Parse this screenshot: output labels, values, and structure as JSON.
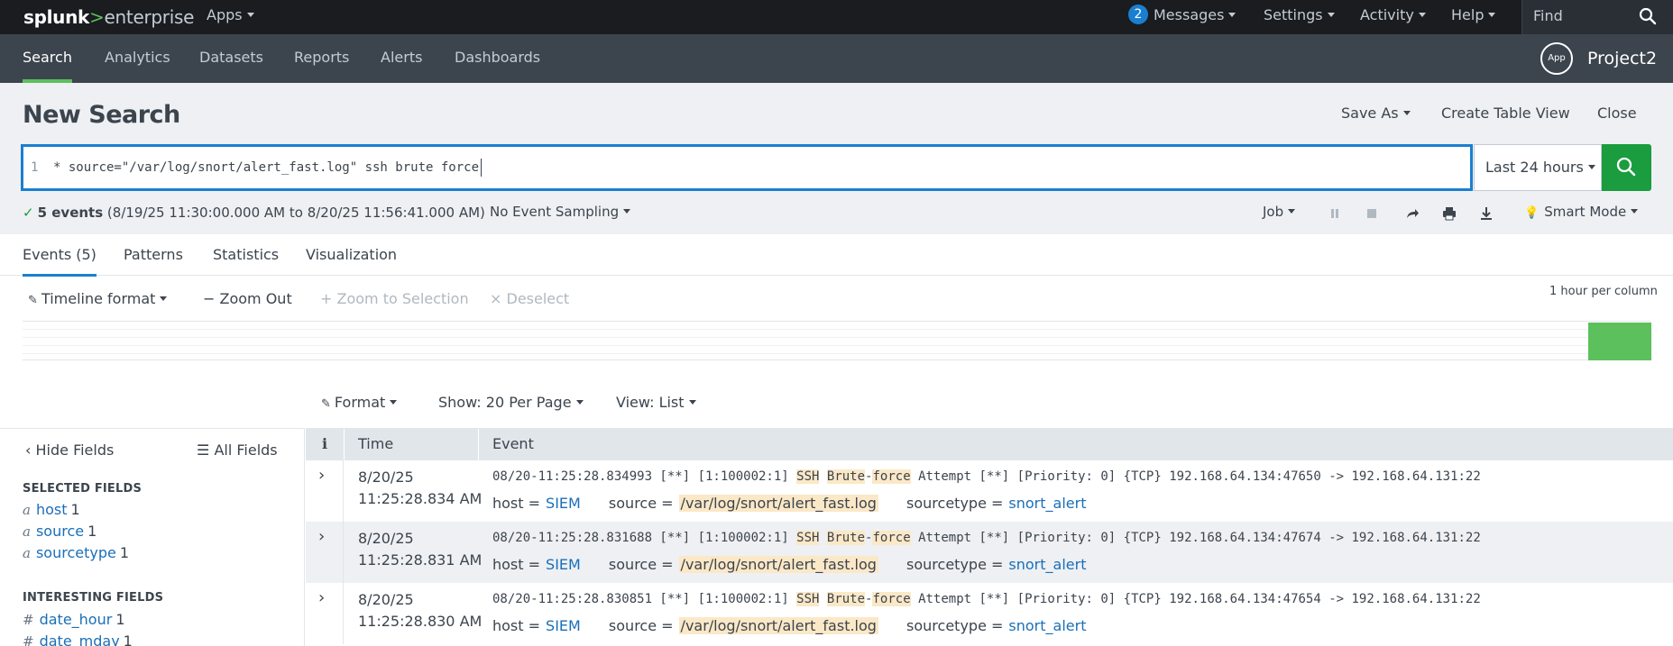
{
  "topbar": {
    "logo_splunk": "splunk",
    "logo_gt": ">",
    "logo_enterprise": "enterprise",
    "apps": "Apps",
    "messages_count": "2",
    "messages": "Messages",
    "settings": "Settings",
    "activity": "Activity",
    "help": "Help",
    "find": "Find"
  },
  "appnav": {
    "tabs": [
      "Search",
      "Analytics",
      "Datasets",
      "Reports",
      "Alerts",
      "Dashboards"
    ],
    "app_icon": "App",
    "app_name": "Project2"
  },
  "header": {
    "title": "New Search",
    "save_as": "Save As",
    "create_table": "Create Table View",
    "close": "Close"
  },
  "search": {
    "line_number": "1",
    "query": "* source=\"/var/log/snort/alert_fast.log\" ssh brute force",
    "time_range": "Last 24 hours"
  },
  "status": {
    "check": "✓",
    "count": "5 events",
    "range": "(8/19/25 11:30:00.000 AM to 8/20/25 11:56:41.000 AM)",
    "sampling": "No Event Sampling",
    "job": "Job",
    "mode": "Smart Mode"
  },
  "result_tabs": [
    "Events (5)",
    "Patterns",
    "Statistics",
    "Visualization"
  ],
  "timeline": {
    "format": "Timeline format",
    "zoom_out": "Zoom Out",
    "zoom_selection": "Zoom to Selection",
    "deselect": "Deselect",
    "scale": "1 hour per column"
  },
  "format_row": {
    "format": "Format",
    "show": "Show: 20 Per Page",
    "view": "View: List"
  },
  "sidebar": {
    "hide_fields": "Hide Fields",
    "all_fields": "All Fields",
    "selected_heading": "SELECTED FIELDS",
    "selected": [
      {
        "type": "a",
        "name": "host",
        "count": "1"
      },
      {
        "type": "a",
        "name": "source",
        "count": "1"
      },
      {
        "type": "a",
        "name": "sourcetype",
        "count": "1"
      }
    ],
    "interesting_heading": "INTERESTING FIELDS",
    "interesting": [
      {
        "type": "#",
        "name": "date_hour",
        "count": "1"
      },
      {
        "type": "#",
        "name": "date_mday",
        "count": "1"
      }
    ]
  },
  "table": {
    "col_info": "i",
    "col_time": "Time",
    "col_event": "Event",
    "rows": [
      {
        "date": "8/20/25",
        "time": "11:25:28.834 AM",
        "raw_pre": "08/20-11:25:28.834993  [**] [1:100002:1] ",
        "raw_w1": "SSH",
        "raw_w2": "Brute",
        "raw_dash": "-",
        "raw_w3": "force",
        "raw_post": " Attempt [**] [Priority: 0] {TCP} 192.168.64.134:47650 -> 192.168.64.131:22",
        "host": "SIEM",
        "source": "/var/log/snort/alert_fast.log",
        "sourcetype": "snort_alert"
      },
      {
        "date": "8/20/25",
        "time": "11:25:28.831 AM",
        "raw_pre": "08/20-11:25:28.831688  [**] [1:100002:1] ",
        "raw_w1": "SSH",
        "raw_w2": "Brute",
        "raw_dash": "-",
        "raw_w3": "force",
        "raw_post": " Attempt [**] [Priority: 0] {TCP} 192.168.64.134:47674 -> 192.168.64.131:22",
        "host": "SIEM",
        "source": "/var/log/snort/alert_fast.log",
        "sourcetype": "snort_alert"
      },
      {
        "date": "8/20/25",
        "time": "11:25:28.830 AM",
        "raw_pre": "08/20-11:25:28.830851  [**] [1:100002:1] ",
        "raw_w1": "SSH",
        "raw_w2": "Brute",
        "raw_dash": "-",
        "raw_w3": "force",
        "raw_post": " Attempt [**] [Priority: 0] {TCP} 192.168.64.134:47654 -> 192.168.64.131:22",
        "host": "SIEM",
        "source": "/var/log/snort/alert_fast.log",
        "sourcetype": "snort_alert"
      }
    ],
    "labels": {
      "host": "host =",
      "source": "source =",
      "sourcetype": "sourcetype ="
    }
  },
  "colors": {
    "accent_green": "#5cc05c",
    "search_button": "#1a9c3f",
    "link_blue": "#1a6fb8",
    "highlight": "#fbe8c7"
  }
}
